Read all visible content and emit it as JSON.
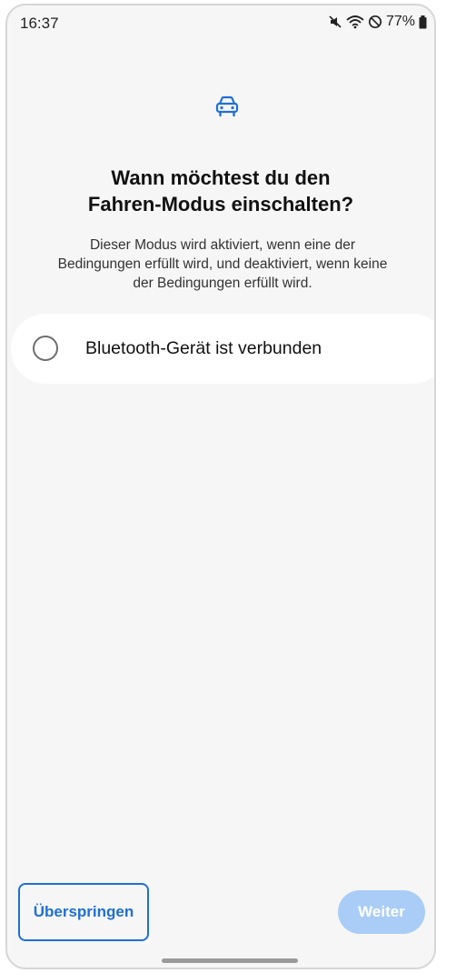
{
  "status_bar": {
    "time": "16:37",
    "battery_percent": "77%",
    "icons": [
      "mute-icon",
      "wifi-icon",
      "do-not-disturb-icon",
      "battery-icon"
    ]
  },
  "header": {
    "icon": "car-icon",
    "title_line1": "Wann möchtest du den",
    "title_line2": "Fahren-Modus einschalten?",
    "subtitle_line1": "Dieser Modus wird aktiviert, wenn eine der",
    "subtitle_line2": "Bedingungen erfüllt wird, und deaktiviert, wenn keine",
    "subtitle_line3": "der Bedingungen erfüllt wird."
  },
  "options": [
    {
      "label": "Bluetooth-Gerät ist verbunden",
      "selected": false
    }
  ],
  "footer": {
    "skip_label": "Überspringen",
    "next_label": "Weiter"
  },
  "colors": {
    "accent": "#1f6fd6",
    "next_disabled": "#a9cdf7",
    "background": "#f6f6f6"
  }
}
